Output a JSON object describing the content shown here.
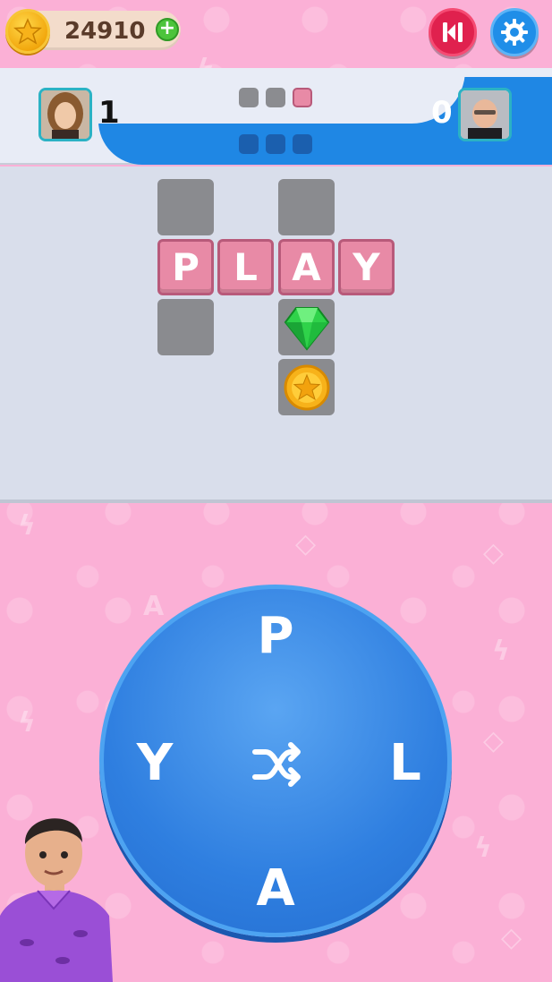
{
  "topbar": {
    "coins": "24910"
  },
  "scoreboard": {
    "left_score": "1",
    "right_score": "0",
    "left_progress": [
      "empty",
      "empty",
      "filled"
    ],
    "right_progress": [
      "empty",
      "empty",
      "empty"
    ]
  },
  "board": {
    "word": [
      "P",
      "L",
      "A",
      "Y"
    ],
    "rewards": [
      "gem",
      "coin"
    ]
  },
  "wheel": {
    "letters": {
      "top": "P",
      "right": "L",
      "bottom": "A",
      "left": "Y"
    }
  },
  "colors": {
    "background": "#fbb0d6",
    "tile": "#e88aa6",
    "wheel": "#2f7fe0",
    "hint_button": "#e0214e",
    "settings_button": "#1f8ee8"
  }
}
